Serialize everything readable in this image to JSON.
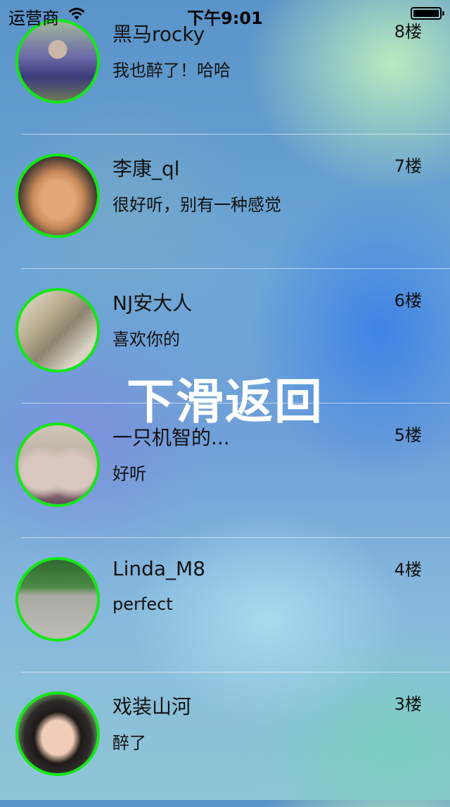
{
  "status_bar": {
    "carrier": "运营商",
    "wifi_icon": "wifi-icon",
    "time": "下午9:01",
    "battery_icon": "battery-icon"
  },
  "overlay_text": "下滑返回",
  "comments": [
    {
      "name": "黑马rocky",
      "comment": "我也醉了！哈哈",
      "floor": "8楼"
    },
    {
      "name": "李康_ql",
      "comment": "很好听，别有一种感觉",
      "floor": "7楼"
    },
    {
      "name": "NJ安大人",
      "comment": "喜欢你的",
      "floor": "6楼"
    },
    {
      "name": "一只机智的...",
      "comment": "好听",
      "floor": "5楼"
    },
    {
      "name": "Linda_M8",
      "comment": "perfect",
      "floor": "4楼"
    },
    {
      "name": "戏装山河",
      "comment": "醉了",
      "floor": "3楼"
    }
  ],
  "colors": {
    "avatar_border": "#12e912",
    "text": "#111111",
    "overlay_text": "#ffffff"
  }
}
